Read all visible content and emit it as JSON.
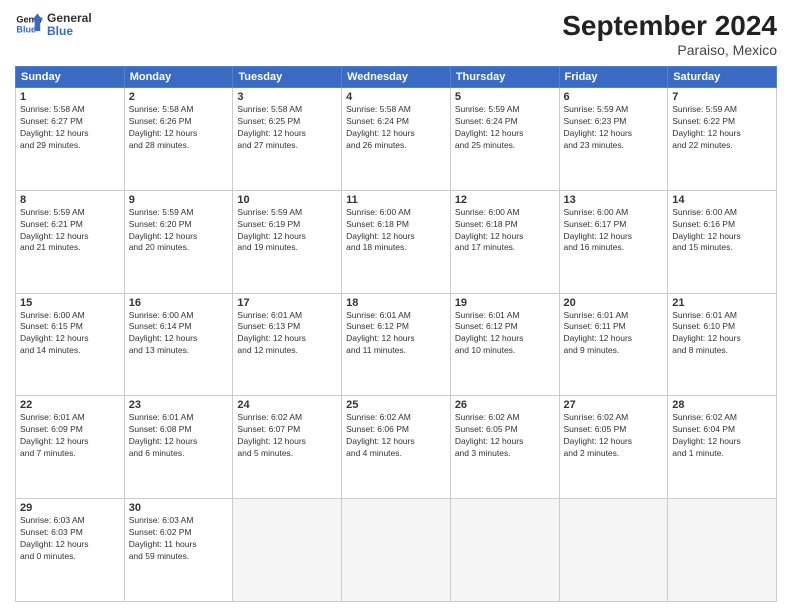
{
  "header": {
    "logo_line1": "General",
    "logo_line2": "Blue",
    "title": "September 2024",
    "location": "Paraiso, Mexico"
  },
  "columns": [
    "Sunday",
    "Monday",
    "Tuesday",
    "Wednesday",
    "Thursday",
    "Friday",
    "Saturday"
  ],
  "weeks": [
    [
      {
        "day": "1",
        "info": "Sunrise: 5:58 AM\nSunset: 6:27 PM\nDaylight: 12 hours\nand 29 minutes."
      },
      {
        "day": "2",
        "info": "Sunrise: 5:58 AM\nSunset: 6:26 PM\nDaylight: 12 hours\nand 28 minutes."
      },
      {
        "day": "3",
        "info": "Sunrise: 5:58 AM\nSunset: 6:25 PM\nDaylight: 12 hours\nand 27 minutes."
      },
      {
        "day": "4",
        "info": "Sunrise: 5:58 AM\nSunset: 6:24 PM\nDaylight: 12 hours\nand 26 minutes."
      },
      {
        "day": "5",
        "info": "Sunrise: 5:59 AM\nSunset: 6:24 PM\nDaylight: 12 hours\nand 25 minutes."
      },
      {
        "day": "6",
        "info": "Sunrise: 5:59 AM\nSunset: 6:23 PM\nDaylight: 12 hours\nand 23 minutes."
      },
      {
        "day": "7",
        "info": "Sunrise: 5:59 AM\nSunset: 6:22 PM\nDaylight: 12 hours\nand 22 minutes."
      }
    ],
    [
      {
        "day": "8",
        "info": "Sunrise: 5:59 AM\nSunset: 6:21 PM\nDaylight: 12 hours\nand 21 minutes."
      },
      {
        "day": "9",
        "info": "Sunrise: 5:59 AM\nSunset: 6:20 PM\nDaylight: 12 hours\nand 20 minutes."
      },
      {
        "day": "10",
        "info": "Sunrise: 5:59 AM\nSunset: 6:19 PM\nDaylight: 12 hours\nand 19 minutes."
      },
      {
        "day": "11",
        "info": "Sunrise: 6:00 AM\nSunset: 6:18 PM\nDaylight: 12 hours\nand 18 minutes."
      },
      {
        "day": "12",
        "info": "Sunrise: 6:00 AM\nSunset: 6:18 PM\nDaylight: 12 hours\nand 17 minutes."
      },
      {
        "day": "13",
        "info": "Sunrise: 6:00 AM\nSunset: 6:17 PM\nDaylight: 12 hours\nand 16 minutes."
      },
      {
        "day": "14",
        "info": "Sunrise: 6:00 AM\nSunset: 6:16 PM\nDaylight: 12 hours\nand 15 minutes."
      }
    ],
    [
      {
        "day": "15",
        "info": "Sunrise: 6:00 AM\nSunset: 6:15 PM\nDaylight: 12 hours\nand 14 minutes."
      },
      {
        "day": "16",
        "info": "Sunrise: 6:00 AM\nSunset: 6:14 PM\nDaylight: 12 hours\nand 13 minutes."
      },
      {
        "day": "17",
        "info": "Sunrise: 6:01 AM\nSunset: 6:13 PM\nDaylight: 12 hours\nand 12 minutes."
      },
      {
        "day": "18",
        "info": "Sunrise: 6:01 AM\nSunset: 6:12 PM\nDaylight: 12 hours\nand 11 minutes."
      },
      {
        "day": "19",
        "info": "Sunrise: 6:01 AM\nSunset: 6:12 PM\nDaylight: 12 hours\nand 10 minutes."
      },
      {
        "day": "20",
        "info": "Sunrise: 6:01 AM\nSunset: 6:11 PM\nDaylight: 12 hours\nand 9 minutes."
      },
      {
        "day": "21",
        "info": "Sunrise: 6:01 AM\nSunset: 6:10 PM\nDaylight: 12 hours\nand 8 minutes."
      }
    ],
    [
      {
        "day": "22",
        "info": "Sunrise: 6:01 AM\nSunset: 6:09 PM\nDaylight: 12 hours\nand 7 minutes."
      },
      {
        "day": "23",
        "info": "Sunrise: 6:01 AM\nSunset: 6:08 PM\nDaylight: 12 hours\nand 6 minutes."
      },
      {
        "day": "24",
        "info": "Sunrise: 6:02 AM\nSunset: 6:07 PM\nDaylight: 12 hours\nand 5 minutes."
      },
      {
        "day": "25",
        "info": "Sunrise: 6:02 AM\nSunset: 6:06 PM\nDaylight: 12 hours\nand 4 minutes."
      },
      {
        "day": "26",
        "info": "Sunrise: 6:02 AM\nSunset: 6:05 PM\nDaylight: 12 hours\nand 3 minutes."
      },
      {
        "day": "27",
        "info": "Sunrise: 6:02 AM\nSunset: 6:05 PM\nDaylight: 12 hours\nand 2 minutes."
      },
      {
        "day": "28",
        "info": "Sunrise: 6:02 AM\nSunset: 6:04 PM\nDaylight: 12 hours\nand 1 minute."
      }
    ],
    [
      {
        "day": "29",
        "info": "Sunrise: 6:03 AM\nSunset: 6:03 PM\nDaylight: 12 hours\nand 0 minutes."
      },
      {
        "day": "30",
        "info": "Sunrise: 6:03 AM\nSunset: 6:02 PM\nDaylight: 11 hours\nand 59 minutes."
      },
      {
        "day": "",
        "info": ""
      },
      {
        "day": "",
        "info": ""
      },
      {
        "day": "",
        "info": ""
      },
      {
        "day": "",
        "info": ""
      },
      {
        "day": "",
        "info": ""
      }
    ]
  ]
}
